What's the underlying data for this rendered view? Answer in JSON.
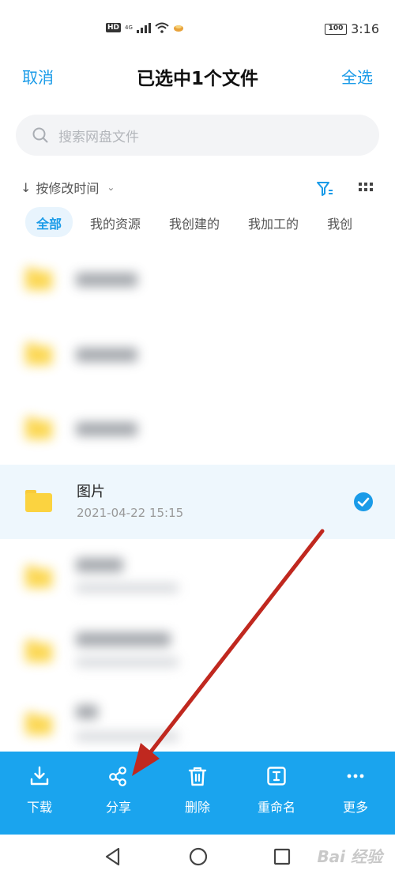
{
  "status_bar": {
    "hd": "HD",
    "network": "4G",
    "battery": "100",
    "time": "3:16"
  },
  "header": {
    "cancel": "取消",
    "title": "已选中1个文件",
    "select_all": "全选"
  },
  "search": {
    "placeholder": "搜索网盘文件"
  },
  "sort": {
    "label": "按修改时间"
  },
  "tabs": [
    {
      "label": "全部"
    },
    {
      "label": "我的资源"
    },
    {
      "label": "我创建的"
    },
    {
      "label": "我加工的"
    },
    {
      "label": "我创"
    }
  ],
  "selected_file": {
    "name": "图片",
    "date": "2021-04-22  15:15"
  },
  "actions": [
    {
      "label": "下载",
      "icon": "download-icon"
    },
    {
      "label": "分享",
      "icon": "share-icon"
    },
    {
      "label": "删除",
      "icon": "trash-icon"
    },
    {
      "label": "重命名",
      "icon": "rename-icon"
    },
    {
      "label": "更多",
      "icon": "more-icon"
    }
  ],
  "nav": {
    "watermark": "Bai 经验"
  },
  "colors": {
    "accent": "#1a9be8",
    "action_bar": "#1aa4ee",
    "folder": "#fbd340",
    "selected_row": "#eef7fd",
    "annotation_arrow": "#c0281f"
  }
}
